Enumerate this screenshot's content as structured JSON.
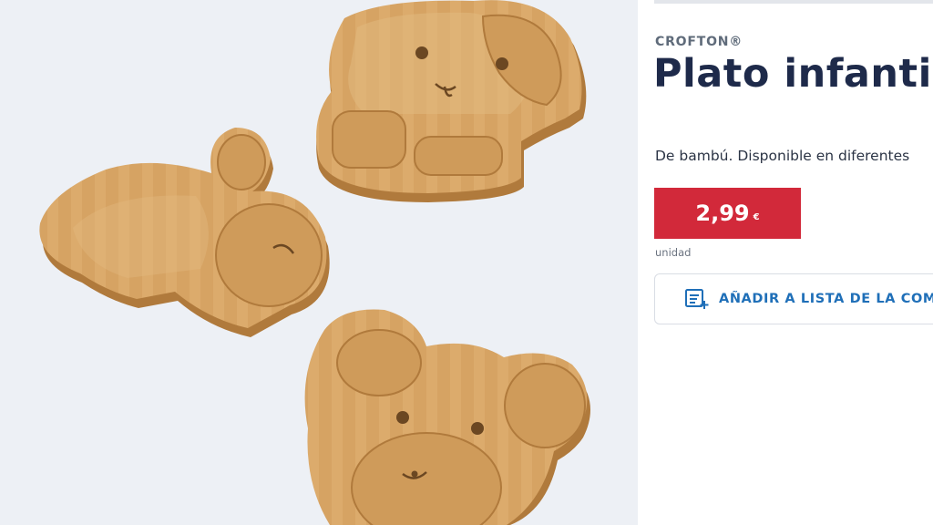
{
  "product": {
    "brand": "CROFTON®",
    "title": "Plato infantil",
    "description": "De bambú. Disponible en diferentes",
    "price": "2,99",
    "currency": "€",
    "unit": "unidad",
    "image_alt": "Platos infantiles de bambú con forma de perro, conejo y oso"
  },
  "actions": {
    "add_to_list_label": "AÑADIR A LISTA DE LA COMPRA",
    "add_to_list_icon": "add-to-list-icon"
  },
  "colors": {
    "price_background": "#d2293a",
    "accent_blue": "#1f6fb8",
    "title_navy": "#1e2a4a",
    "image_background": "#edf0f5",
    "bamboo": "#d8a868"
  }
}
